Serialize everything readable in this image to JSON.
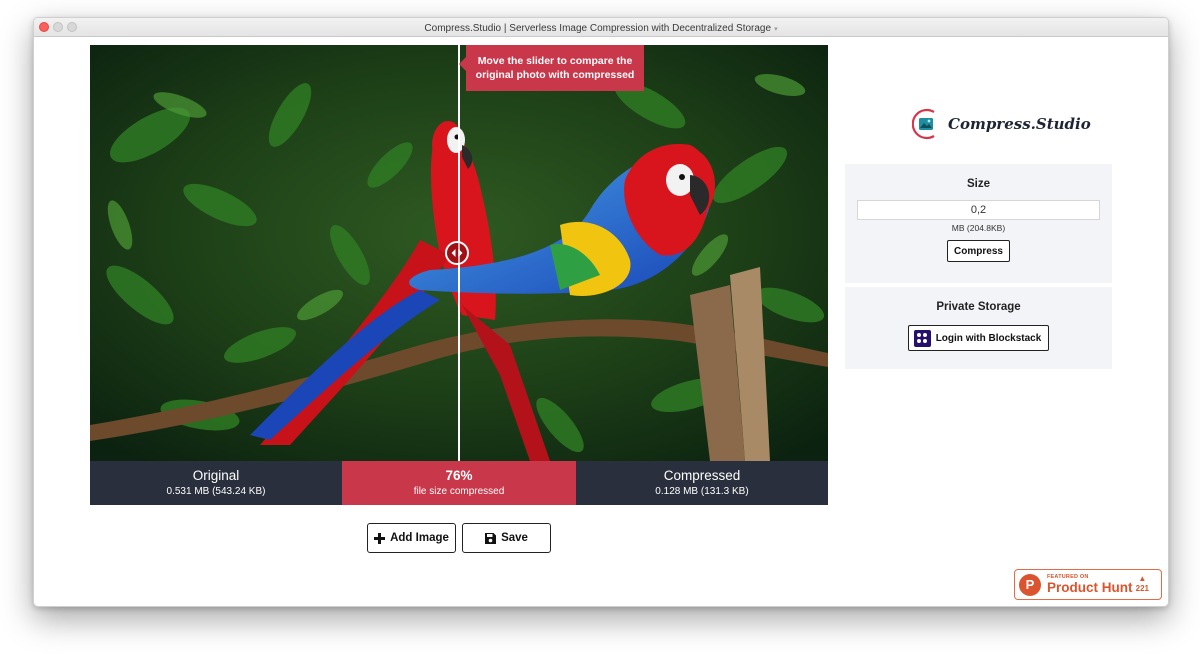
{
  "window": {
    "title": "Compress.Studio | Serverless Image Compression with Decentralized Storage"
  },
  "compare": {
    "tooltip_line1": "Move the slider to compare the",
    "tooltip_line2": "original photo with compressed",
    "slider_position": 0.5
  },
  "stats": {
    "original": {
      "label": "Original",
      "value": "0.531 MB (543.24 KB)"
    },
    "percent": {
      "label": "76%",
      "value": "file size compressed"
    },
    "compressed": {
      "label": "Compressed",
      "value": "0.128 MB (131.3 KB)"
    }
  },
  "actions": {
    "add_label": "Add Image",
    "save_label": "Save"
  },
  "brand": {
    "name": "Compress.Studio"
  },
  "size_panel": {
    "title": "Size",
    "input_value": "0,2",
    "sub_label": "MB (204.8KB)",
    "compress_label": "Compress"
  },
  "storage_panel": {
    "title": "Private Storage",
    "login_label": "Login with Blockstack"
  },
  "product_hunt": {
    "featured": "FEATURED ON",
    "name": "Product Hunt",
    "votes": "221"
  },
  "colors": {
    "accent": "#c8374a",
    "dark": "#2a2f3d",
    "panel": "#f3f4f8",
    "product_hunt": "#da552f",
    "blockstack": "#25106e"
  },
  "icons": [
    "plus-icon",
    "floppy-disk-icon",
    "blockstack-icon",
    "product-hunt-icon",
    "slider-arrows-icon",
    "upvote-arrow-icon"
  ]
}
